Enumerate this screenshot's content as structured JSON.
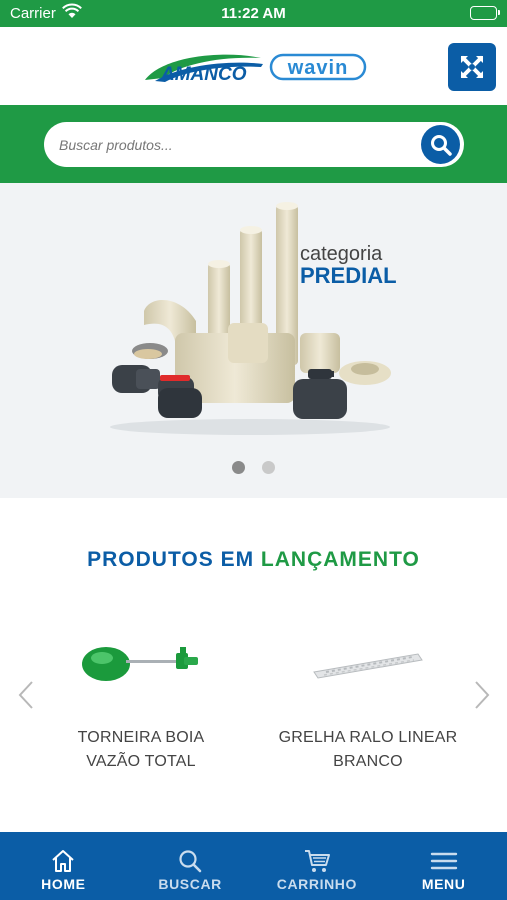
{
  "status_bar": {
    "carrier": "Carrier",
    "time": "11:22 AM"
  },
  "header": {
    "brand_left": "AMANCO",
    "brand_right": "wavin",
    "menu_icon": "crossed-arrows-icon",
    "accent_color": "#0b5da6"
  },
  "search": {
    "placeholder": "Buscar produtos...",
    "value": "",
    "icon": "search-icon"
  },
  "banner": {
    "category_label": "categoria",
    "category_name": "PREDIAL",
    "slides_total": 2,
    "active_slide": 1
  },
  "launch_section": {
    "title_part1": "PRODUTOS EM",
    "title_part2": "LANÇAMENTO",
    "products": [
      {
        "line1": "TORNEIRA BOIA",
        "line2": "VAZÃO TOTAL"
      },
      {
        "line1": "GRELHA RALO LINEAR",
        "line2": "BRANCO"
      }
    ]
  },
  "tab_bar": {
    "tabs": [
      {
        "label": "HOME",
        "icon": "home-icon"
      },
      {
        "label": "BUSCAR",
        "icon": "search-icon"
      },
      {
        "label": "CARRINHO",
        "icon": "cart-icon"
      },
      {
        "label": "MENU",
        "icon": "hamburger-icon"
      }
    ],
    "active": "HOME"
  },
  "colors": {
    "green": "#1f9a45",
    "blue": "#0b5da6",
    "banner_bg": "#f1f3f5"
  }
}
